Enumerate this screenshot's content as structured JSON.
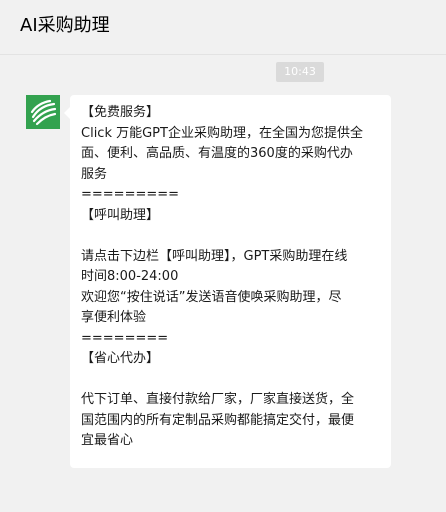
{
  "header": {
    "title": "AI采购助理"
  },
  "chat": {
    "timestamp": "10:43",
    "avatar_icon": "leaf-logo-icon",
    "brand_color": "#33a24f",
    "message_lines": [
      "【免费服务】",
      "Click 万能GPT企业采购助理，在全国为您提供全",
      "面、便利、高品质、有温度的360度的采购代办",
      "服务",
      "=========",
      "【呼叫助理】",
      "",
      "请点击下边栏【呼叫助理】，GPT采购助理在线",
      "时间8:00-24:00",
      "欢迎您“按住说话”发送语音使唤采购助理，尽",
      "享便利体验",
      "========",
      "【省心代办】",
      "",
      "代下订单、直接付款给厂家，厂家直接送货，全",
      "国范围内的所有定制品采购都能搞定交付，最便",
      "宜最省心"
    ]
  }
}
